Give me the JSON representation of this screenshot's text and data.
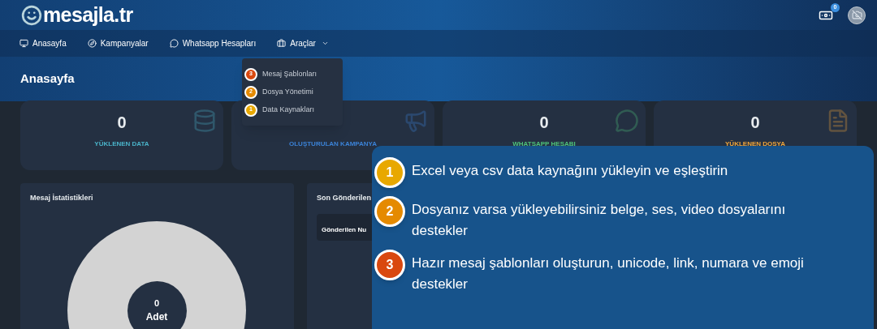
{
  "header": {
    "logo": "mesajla.tr",
    "balance_badge": "0"
  },
  "nav": [
    {
      "label": "Anasayfa"
    },
    {
      "label": "Kampanyalar"
    },
    {
      "label": "Whatsapp Hesapları"
    },
    {
      "label": "Araçlar",
      "menu": [
        {
          "badge": "3",
          "label": "Mesaj Şablonları",
          "color": "#d9480f"
        },
        {
          "badge": "2",
          "label": "Dosya Yönetimi",
          "color": "#e58a00"
        },
        {
          "badge": "1",
          "label": "Data Kaynakları",
          "color": "#e8a800"
        }
      ]
    }
  ],
  "page_title": "Anasayfa",
  "stats": [
    {
      "value": "0",
      "label": "YÜKLENEN DATA",
      "color": "#4ab3c9"
    },
    {
      "label": "OLUŞTURULAN KAMPANYA",
      "color": "#3b82d6"
    },
    {
      "value": "0",
      "label": "WHATSAPP HESABI",
      "color": "#4ec27a"
    },
    {
      "value": "0",
      "label": "YÜKLENEN DOSYA",
      "color": "#f0a53a"
    }
  ],
  "panels": {
    "stats_title": "Mesaj İstatistikleri",
    "donut_value": "0",
    "donut_unit": "Adet",
    "recent_title": "Son Gönderilen",
    "recent_column_1": "Gönderilen Nu"
  },
  "callout": [
    {
      "badge": "1",
      "text": "Excel veya csv data kaynağını yükleyin ve eşleştirin",
      "color": "#e8a800"
    },
    {
      "badge": "2",
      "text": "Dosyanız varsa yükleyebilirsiniz belge, ses, video dosyalarını destekler",
      "color": "#e58a00"
    },
    {
      "badge": "3",
      "text": "Hazır mesaj şablonları oluşturun, unicode, link, numara ve emoji destekler",
      "color": "#d9480f"
    }
  ]
}
